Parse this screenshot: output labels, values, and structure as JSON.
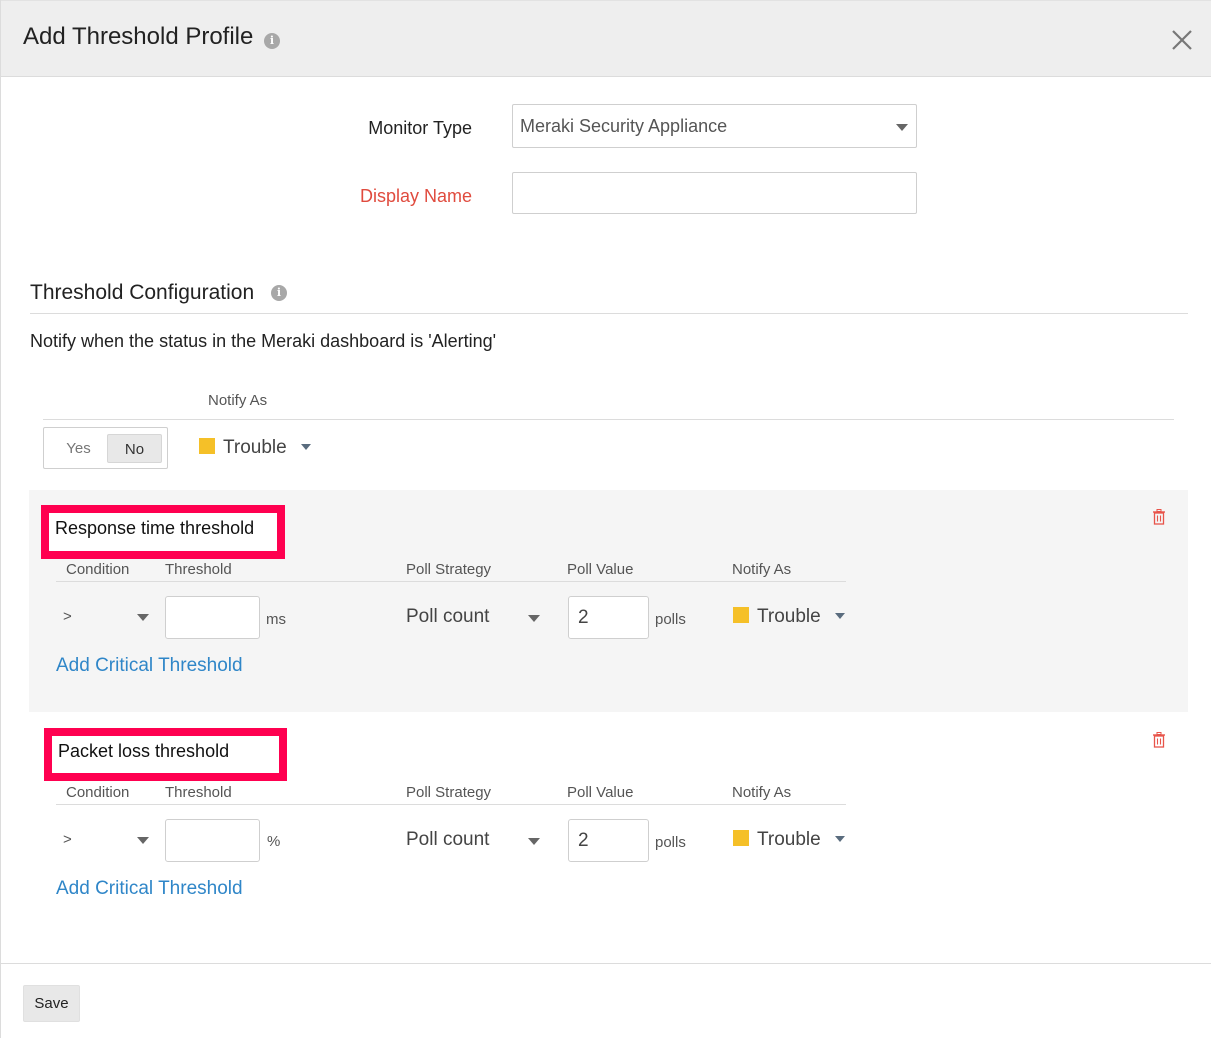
{
  "header": {
    "title": "Add Threshold Profile",
    "info_icon": "info-icon",
    "close_icon": "close-icon"
  },
  "form": {
    "monitor_type_label": "Monitor Type",
    "monitor_type_value": "Meraki Security Appliance",
    "display_name_label": "Display Name",
    "display_name_value": "",
    "display_name_required": true
  },
  "threshold_configuration": {
    "title": "Threshold Configuration",
    "info_icon": "info-icon",
    "notify_text": "Notify when the status in the Meraki dashboard is 'Alerting'",
    "notify_as_header": "Notify As",
    "toggle": {
      "yes_label": "Yes",
      "no_label": "No",
      "selected": "No"
    },
    "notify_as": {
      "label": "Trouble",
      "color": "#f5c028"
    }
  },
  "thresholds": [
    {
      "title": "Response time threshold",
      "headers": {
        "condition": "Condition",
        "threshold": "Threshold",
        "poll_strategy": "Poll Strategy",
        "poll_value": "Poll Value",
        "notify_as": "Notify As"
      },
      "condition": ">",
      "threshold_value": "",
      "unit": "ms",
      "poll_strategy": "Poll count",
      "poll_value": "2",
      "poll_unit": "polls",
      "notify_as": "Trouble",
      "notify_color": "#f5c028",
      "add_critical_label": "Add Critical Threshold",
      "delete_icon": "trash-icon"
    },
    {
      "title": "Packet loss threshold",
      "headers": {
        "condition": "Condition",
        "threshold": "Threshold",
        "poll_strategy": "Poll Strategy",
        "poll_value": "Poll Value",
        "notify_as": "Notify As"
      },
      "condition": ">",
      "threshold_value": "",
      "unit": "%",
      "poll_strategy": "Poll count",
      "poll_value": "2",
      "poll_unit": "polls",
      "notify_as": "Trouble",
      "notify_color": "#f5c028",
      "add_critical_label": "Add Critical Threshold",
      "delete_icon": "trash-icon"
    }
  ],
  "footer": {
    "save_label": "Save"
  },
  "colors": {
    "required_label": "#e04b3e",
    "link": "#2f86c8",
    "highlight_box": "#ff0050",
    "trouble": "#f5c028",
    "delete": "#e8544a"
  }
}
